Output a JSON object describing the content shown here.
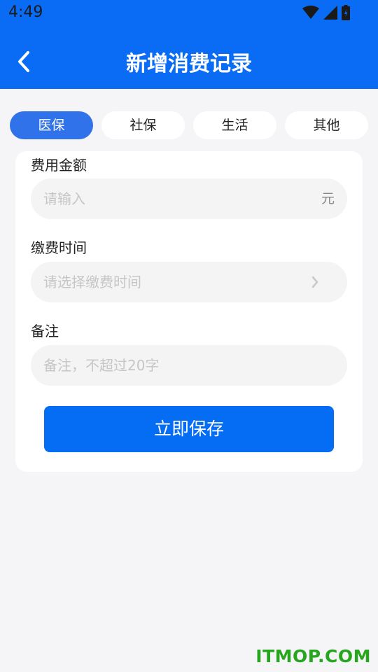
{
  "status_bar": {
    "time": "4:49"
  },
  "header": {
    "title": "新增消费记录"
  },
  "tabs": [
    {
      "label": "医保",
      "active": true
    },
    {
      "label": "社保",
      "active": false
    },
    {
      "label": "生活",
      "active": false
    },
    {
      "label": "其他",
      "active": false
    }
  ],
  "form": {
    "amount": {
      "label": "费用金额",
      "placeholder": "请输入",
      "value": "",
      "suffix": "元"
    },
    "payment_time": {
      "label": "缴费时间",
      "placeholder": "请选择缴费时间",
      "value": ""
    },
    "note": {
      "label": "备注",
      "placeholder": "备注，不超过20字",
      "value": ""
    }
  },
  "save_button": {
    "label": "立即保存"
  },
  "watermark": "ITMOP.COM",
  "colors": {
    "primary": "#0a6cf5",
    "tab_active": "#2f72ea",
    "page_bg": "#f5f5f7",
    "input_bg": "#f4f4f4",
    "watermark": "#27a51f"
  }
}
